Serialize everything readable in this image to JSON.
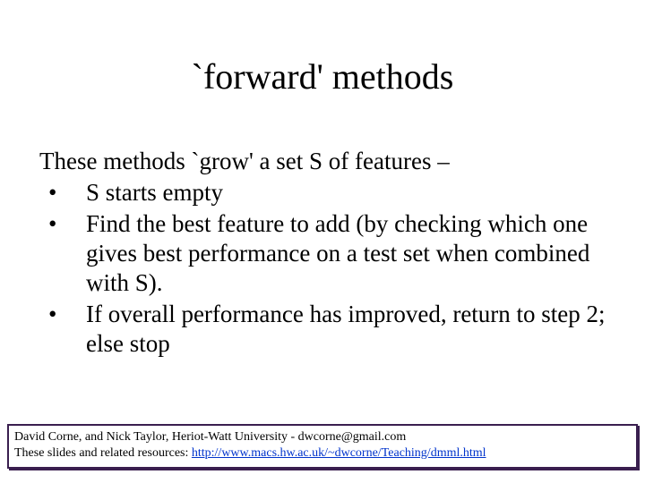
{
  "title": "`forward' methods",
  "intro": "These methods `grow' a set S of features –",
  "bullets": [
    "S starts empty",
    "Find the best feature to add (by checking which one gives best performance on a test set when combined with S).",
    "If overall performance has improved, return to step 2; else stop"
  ],
  "footer": {
    "line1": "David Corne, and Nick Taylor,  Heriot-Watt University  -  dwcorne@gmail.com",
    "line2_prefix": "These slides and related resources:   ",
    "link_text": "http://www.macs.hw.ac.uk/~dwcorne/Teaching/dmml.html"
  }
}
